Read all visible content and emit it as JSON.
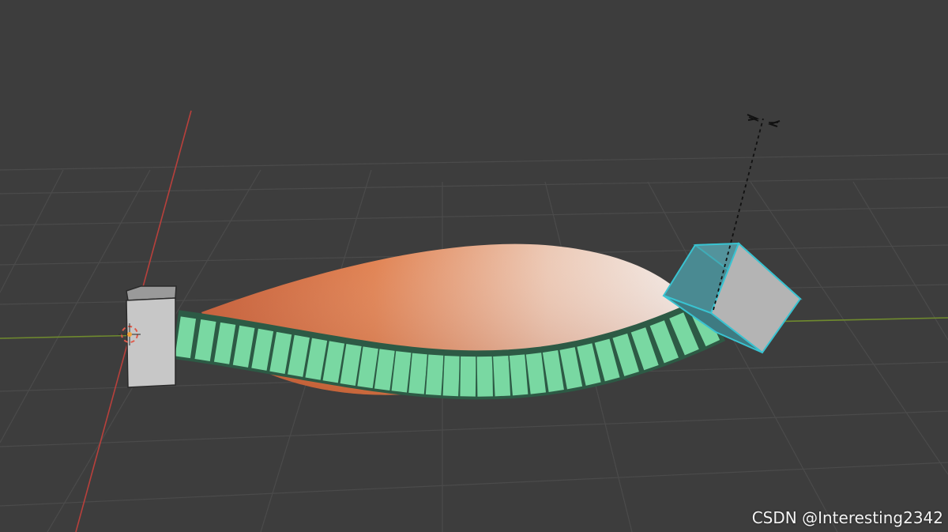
{
  "viewport": {
    "background": "#3d3d3d",
    "grid_color": "#4c4c4c",
    "x_axis_color": "#b8403c",
    "y_axis_color": "#6f8a2e",
    "objects": {
      "anchor_cube": "light grey cube",
      "target_cube": "selected cube with cyan outline",
      "chain": "green segmented chain",
      "volume": "orange gradient shape"
    },
    "colors": {
      "selected_outline": "#39c3d1",
      "chain_fill": "#79d8a2",
      "chain_edge": "#2d5a45",
      "cube_fill": "#c7c7c7",
      "volume_warm": "#d9653a",
      "volume_light": "#eedfd7"
    }
  },
  "watermark": {
    "text": "CSDN @Interesting2342"
  }
}
